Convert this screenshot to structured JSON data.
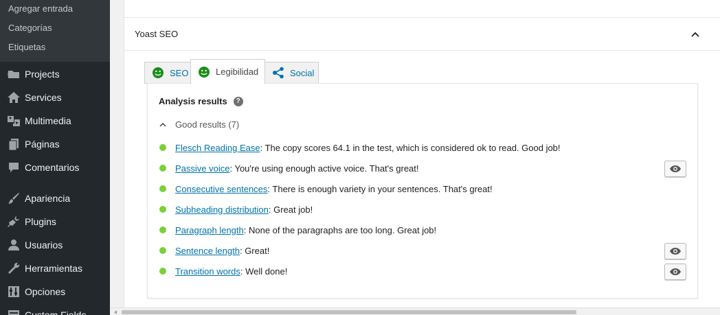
{
  "sidebar": {
    "submenu": [
      {
        "label": "Agregar entrada"
      },
      {
        "label": "Categorías"
      },
      {
        "label": "Etiquetas"
      }
    ],
    "menu": [
      {
        "label": "Projects",
        "icon": "folder-icon"
      },
      {
        "label": "Services",
        "icon": "home-icon"
      },
      {
        "label": "Multimedia",
        "icon": "media-icon"
      },
      {
        "label": "Páginas",
        "icon": "pages-icon"
      },
      {
        "label": "Comentarios",
        "icon": "comment-icon"
      },
      {
        "label": "Apariencia",
        "icon": "paintbrush-icon"
      },
      {
        "label": "Plugins",
        "icon": "plugin-icon"
      },
      {
        "label": "Usuarios",
        "icon": "user-icon"
      },
      {
        "label": "Herramientas",
        "icon": "wrench-icon"
      },
      {
        "label": "Opciones",
        "icon": "settings-icon"
      },
      {
        "label": "Custom Fields",
        "icon": "custom-fields-icon"
      }
    ]
  },
  "panel": {
    "title": "Yoast SEO",
    "tabs": [
      {
        "label": "SEO",
        "icon": "smiley-icon",
        "active": false
      },
      {
        "label": "Legibilidad",
        "icon": "smiley-icon",
        "active": true
      },
      {
        "label": "Social",
        "icon": "share-icon",
        "active": false
      }
    ]
  },
  "analysis": {
    "heading": "Analysis results",
    "help": "?",
    "group_label": "Good results (7)",
    "results": [
      {
        "link": "Flesch Reading Ease",
        "text": ": The copy scores 64.1 in the test, which is considered ok to read. Good job!",
        "eye": false
      },
      {
        "link": "Passive voice",
        "text": ": You're using enough active voice. That's great!",
        "eye": true
      },
      {
        "link": "Consecutive sentences",
        "text": ": There is enough variety in your sentences. That's great!",
        "eye": false
      },
      {
        "link": "Subheading distribution",
        "text": ": Great job!",
        "eye": false
      },
      {
        "link": "Paragraph length",
        "text": ": None of the paragraphs are too long. Great job!",
        "eye": false
      },
      {
        "link": "Sentence length",
        "text": ": Great!",
        "eye": true
      },
      {
        "link": "Transition words",
        "text": ": Well done!",
        "eye": true
      }
    ]
  },
  "colors": {
    "sidebar_bg": "#23282d",
    "link": "#0073aa",
    "good": "#7ad03a",
    "smiley": "#1b8c1b"
  }
}
